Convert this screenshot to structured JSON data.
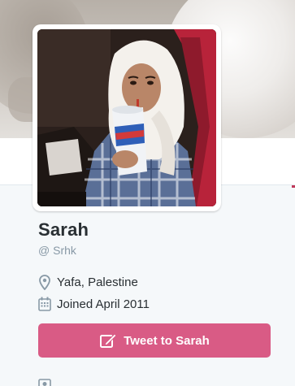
{
  "profile": {
    "name": "Sarah",
    "handle": "@ Srhk",
    "location": "Yafa, Palestine",
    "joined": "Joined April 2011"
  },
  "actions": {
    "tweet_to_label": "Tweet to Sarah"
  },
  "icons": {
    "location": "map-pin-icon",
    "joined": "calendar-icon",
    "tweet_to": "compose-icon",
    "photos": "photo-icon"
  },
  "colors": {
    "tweet_button": "#d95b85",
    "name_text": "#292f33",
    "muted_text": "#8899a6",
    "accent": "#c0395a"
  }
}
